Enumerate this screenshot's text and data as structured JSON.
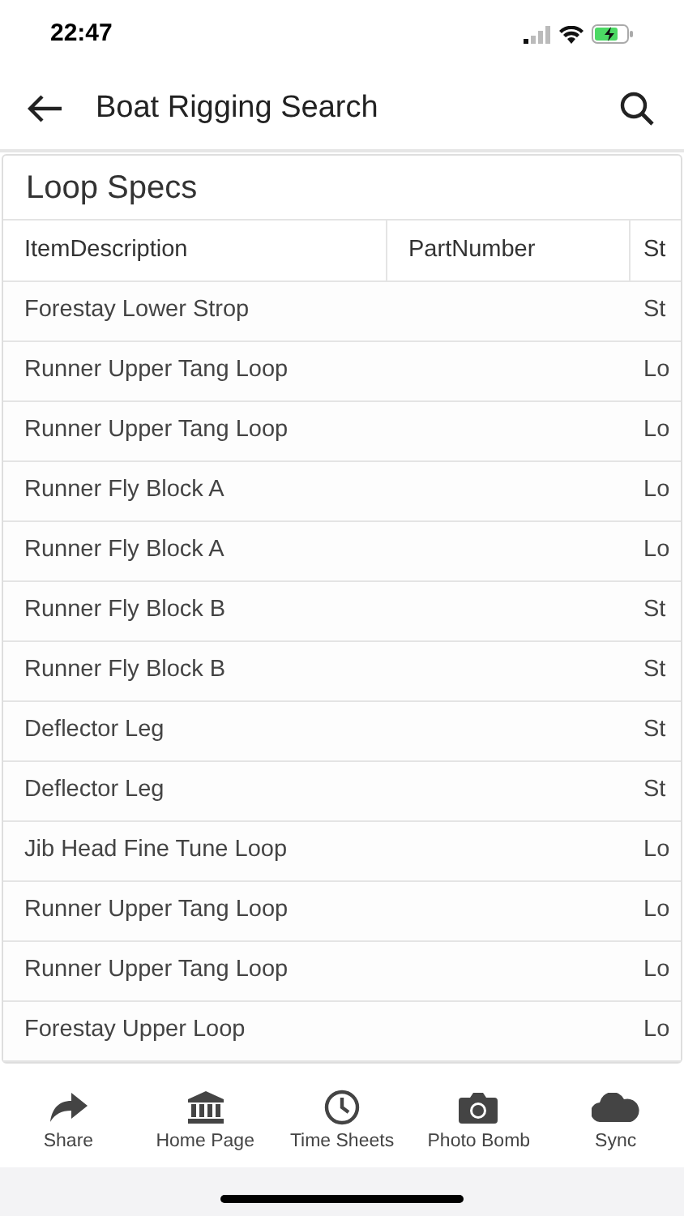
{
  "status_bar": {
    "time": "22:47"
  },
  "header": {
    "title": "Boat Rigging Search"
  },
  "card": {
    "title": "Loop Specs",
    "table": {
      "columns": [
        "ItemDescription",
        "PartNumber",
        "St"
      ],
      "rows": [
        [
          "Forestay Lower Strop",
          "",
          "St"
        ],
        [
          "Runner Upper Tang Loop",
          "",
          "Lo"
        ],
        [
          "Runner Upper Tang Loop",
          "",
          "Lo"
        ],
        [
          "Runner Fly Block A",
          "",
          "Lo"
        ],
        [
          "Runner Fly Block A",
          "",
          "Lo"
        ],
        [
          "Runner Fly Block B",
          "",
          "St"
        ],
        [
          "Runner Fly Block B",
          "",
          "St"
        ],
        [
          "Deflector Leg",
          "",
          "St"
        ],
        [
          "Deflector Leg",
          "",
          "St"
        ],
        [
          "Jib Head Fine Tune Loop",
          "",
          "Lo"
        ],
        [
          "Runner Upper Tang Loop",
          "",
          "Lo"
        ],
        [
          "Runner Upper Tang Loop",
          "",
          "Lo"
        ],
        [
          "Forestay Upper Loop",
          "",
          "Lo"
        ]
      ]
    }
  },
  "tab_bar": [
    {
      "kind": "share",
      "label": "Share"
    },
    {
      "kind": "home",
      "label": "Home Page"
    },
    {
      "kind": "clock",
      "label": "Time Sheets"
    },
    {
      "kind": "camera",
      "label": "Photo Bomb"
    },
    {
      "kind": "cloud",
      "label": "Sync"
    }
  ]
}
